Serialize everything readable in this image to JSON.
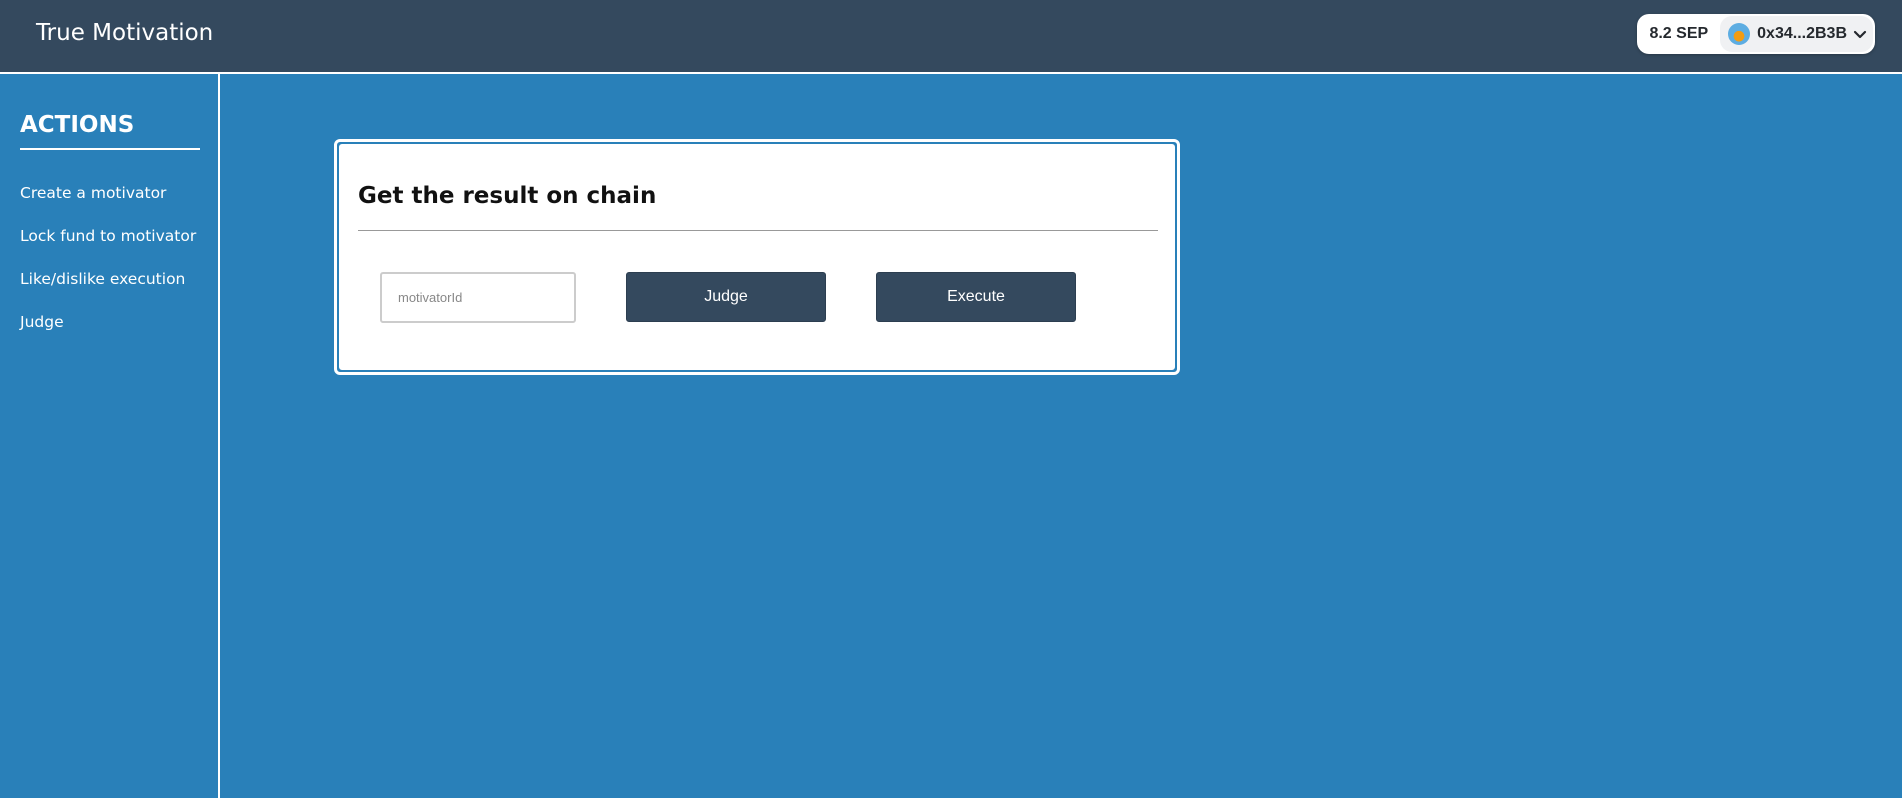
{
  "header": {
    "title": "True Motivation"
  },
  "wallet": {
    "balance": "8.2 SEP",
    "account": "0x34...2B3B",
    "avatar_icon": "network-avatar-icon",
    "chevron_icon": "chevron-down-icon"
  },
  "sidebar": {
    "heading": "ACTIONS",
    "items": [
      {
        "label": "Create a motivator"
      },
      {
        "label": "Lock fund to motivator"
      },
      {
        "label": "Like/dislike execution"
      },
      {
        "label": "Judge"
      }
    ]
  },
  "card": {
    "title": "Get the result on chain",
    "input_placeholder": "motivatorId",
    "input_value": "",
    "judge_label": "Judge",
    "execute_label": "Execute"
  },
  "colors": {
    "header_bg": "#34495e",
    "page_bg": "#2980b9",
    "button_bg": "#34495e",
    "card_bg": "#ffffff"
  }
}
